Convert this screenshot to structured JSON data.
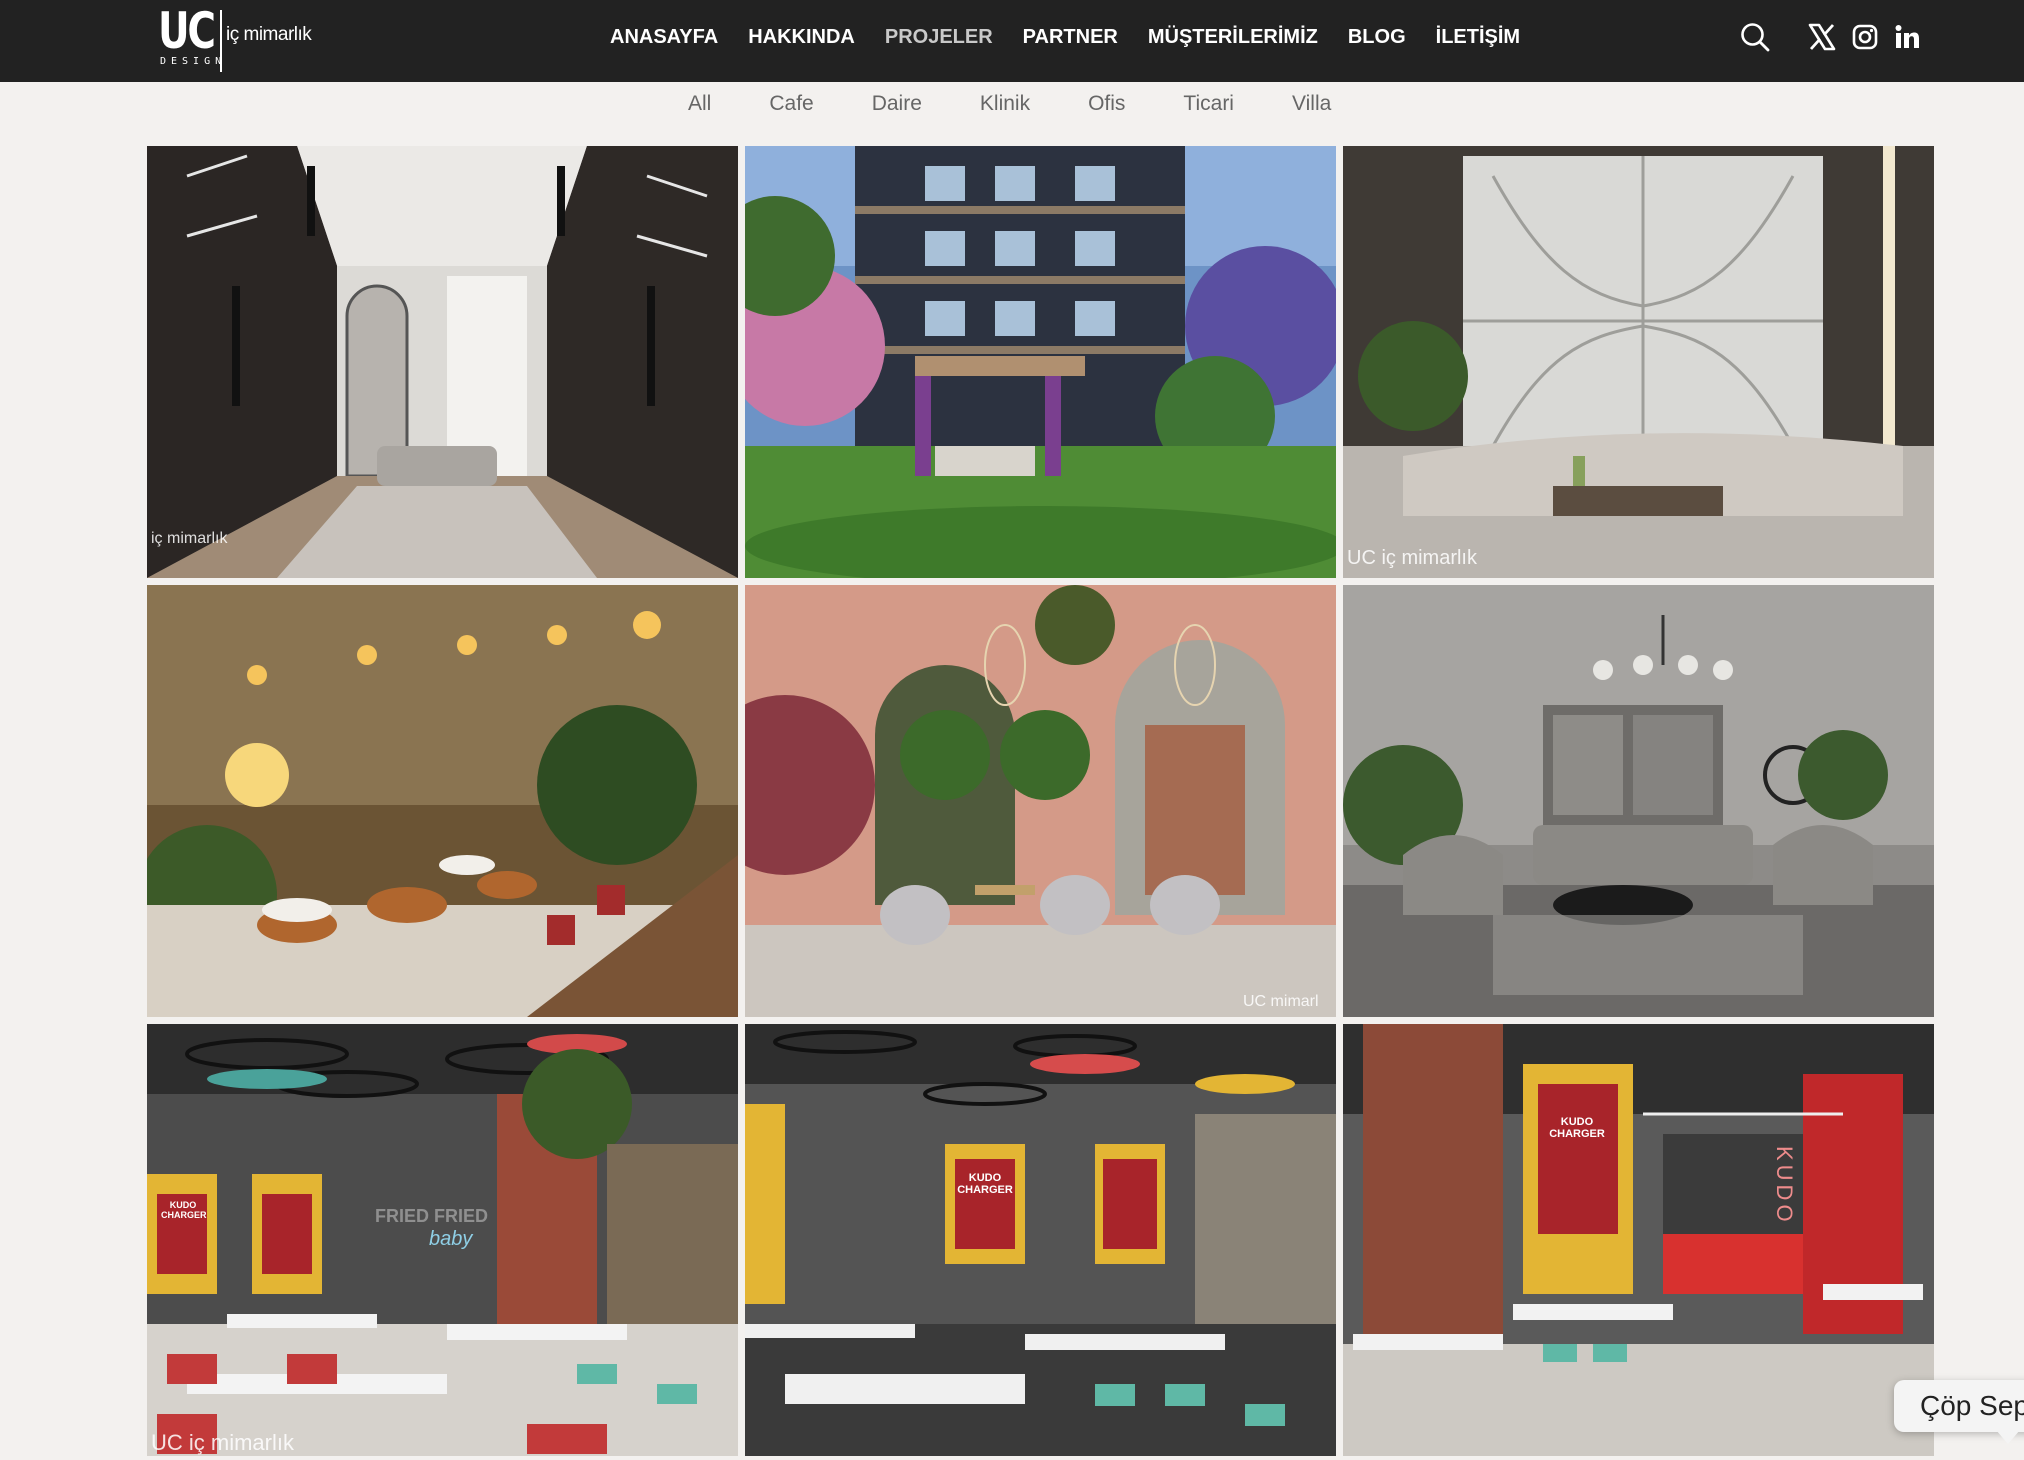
{
  "logo": {
    "mark": "UC",
    "sub": "DESIGN",
    "tagline": "iç mimarlık"
  },
  "nav": {
    "items": [
      {
        "label": "ANASAYFA"
      },
      {
        "label": "HAKKINDA"
      },
      {
        "label": "PROJELER",
        "active": true
      },
      {
        "label": "PARTNER"
      },
      {
        "label": "MÜŞTERİLERİMİZ"
      },
      {
        "label": "BLOG"
      },
      {
        "label": "İLETİŞİM"
      }
    ]
  },
  "header_icons": [
    "search-icon",
    "x-twitter-icon",
    "instagram-icon",
    "linkedin-icon"
  ],
  "filters": [
    "All",
    "Cafe",
    "Daire",
    "Klinik",
    "Ofis",
    "Ticari",
    "Villa"
  ],
  "gallery": {
    "tiles": [
      {
        "name": "walk-in-closet",
        "watermark": "iç mimarlık"
      },
      {
        "name": "residential-building-garden",
        "watermark": ""
      },
      {
        "name": "marble-living-room",
        "watermark": "UC iç mimarlık"
      },
      {
        "name": "cafe-warm-lights",
        "watermark": ""
      },
      {
        "name": "cafe-pink-arches",
        "watermark": "UC mimarl"
      },
      {
        "name": "grey-living-room",
        "watermark": ""
      },
      {
        "name": "kudo-restaurant-1",
        "watermark": "UC iç mimarlık",
        "sign": "FRIED FRIED",
        "sign2": "baby",
        "poster": "KUDO CHARGER"
      },
      {
        "name": "kudo-restaurant-2",
        "watermark": "",
        "poster": "KUDO CHARGER"
      },
      {
        "name": "kudo-restaurant-3",
        "watermark": "",
        "poster": "KUDO CHARGER",
        "neon": "KUDO"
      }
    ]
  },
  "chat_chip": {
    "label": "Çöp Sep"
  },
  "colors": {
    "header_bg": "#222222",
    "page_bg": "#f3f1ef",
    "nav_active": "#c9c9c9",
    "filter_text": "#666666"
  }
}
